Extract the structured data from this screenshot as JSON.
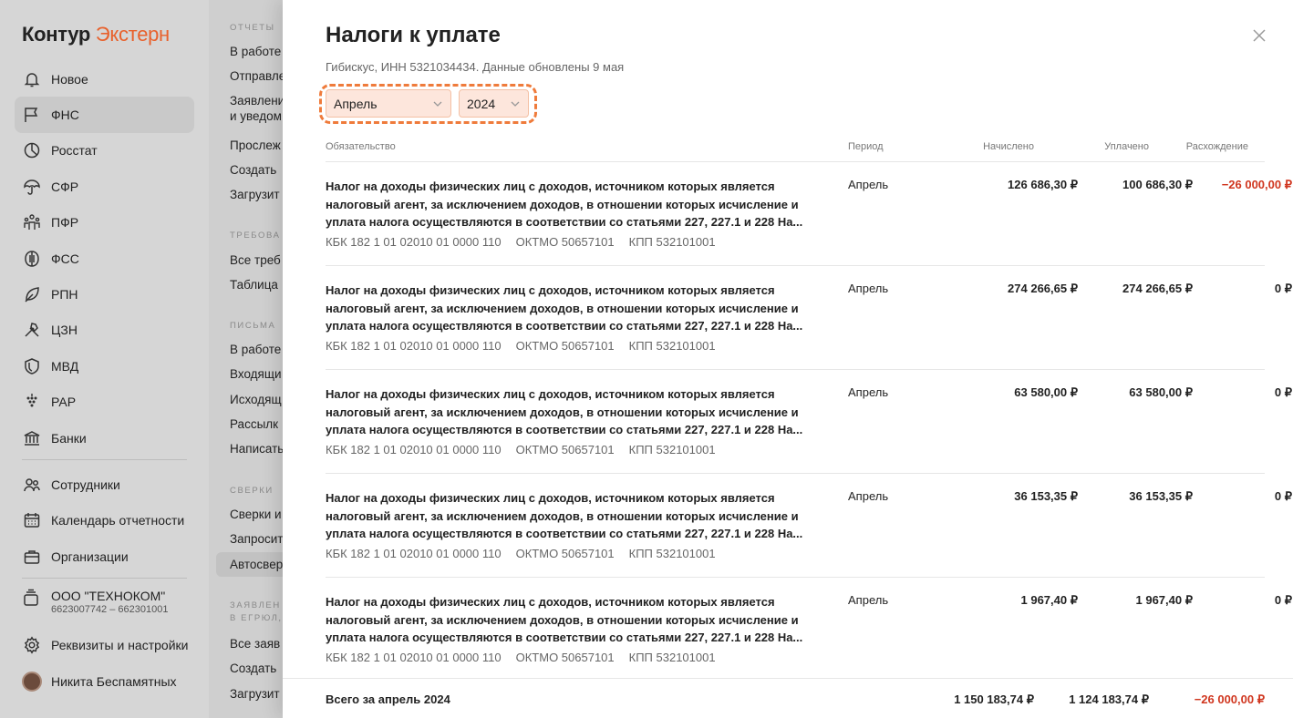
{
  "sidebar": {
    "logo_part1": "Контур",
    "logo_part2": "Экстерн",
    "items": [
      {
        "label": "Новое",
        "icon": "bell-icon"
      },
      {
        "label": "ФНС",
        "icon": "flag-icon"
      },
      {
        "label": "Росстат",
        "icon": "pie-chart-icon"
      },
      {
        "label": "СФР",
        "icon": "umbrella-icon"
      },
      {
        "label": "ПФР",
        "icon": "people-icon"
      },
      {
        "label": "ФСС",
        "icon": "shield-half-icon"
      },
      {
        "label": "РПН",
        "icon": "leaf-icon"
      },
      {
        "label": "ЦЗН",
        "icon": "tools-icon"
      },
      {
        "label": "МВД",
        "icon": "shield-icon"
      },
      {
        "label": "РАР",
        "icon": "grapes-icon"
      },
      {
        "label": "Банки",
        "icon": "bank-icon"
      }
    ],
    "extra": [
      {
        "label": "Сотрудники",
        "icon": "employees-icon"
      },
      {
        "label": "Календарь отчетности",
        "icon": "calendar-icon"
      },
      {
        "label": "Организации",
        "icon": "briefcase-icon"
      }
    ],
    "org_name": "ООО \"ТЕХНОКОМ\"",
    "org_inn": "6623007742 – 662301001",
    "settings_label": "Реквизиты и настройки",
    "user_name": "Никита Беспамятных"
  },
  "menu2": {
    "sec1_title": "ОТЧЕТЫ",
    "sec1": [
      "В работе",
      "Отправле",
      "Заявлени",
      "и уведом",
      "Прослеж",
      "Создать",
      "Загрузит"
    ],
    "sec2_title": "ТРЕБОВА",
    "sec2": [
      "Все треб",
      "Таблица"
    ],
    "sec3_title": "ПИСЬМА",
    "sec3": [
      "В работе",
      "Входящи",
      "Исходящ",
      "Рассылк",
      "Написать"
    ],
    "sec4_title": "СВЕРКИ",
    "sec4": [
      "Сверки и",
      "Запросит",
      "Автосвер"
    ],
    "sec5_title1": "ЗАЯВЛЕН",
    "sec5_title2": "В ЕГРЮЛ,",
    "sec5": [
      "Все заяв",
      "Создать",
      "Загрузит"
    ]
  },
  "modal": {
    "title": "Налоги к уплате",
    "subtitle": "Гибискус, ИНН 5321034434. Данные обновлены 9 мая",
    "month": "Апрель",
    "year": "2024",
    "columns": {
      "obligation": "Обязательство",
      "period": "Период",
      "accrued": "Начислено",
      "paid": "Уплачено",
      "diff": "Расхождение"
    },
    "rows": [
      {
        "desc": "Налог на доходы физических лиц с доходов, источником которых является налоговый агент, за исключением доходов, в отношении которых исчисление и уплата налога осуществляются в соответствии со статьями 227, 227.1 и 228 На...",
        "kbk": "КБК 182 1 01 02010 01 0000 110",
        "oktmo": "ОКТМО 50657101",
        "kpp": "КПП 532101001",
        "period": "Апрель",
        "accrued": "126 686,30 ₽",
        "paid": "100 686,30 ₽",
        "diff": "−26 000,00 ₽"
      },
      {
        "desc": "Налог на доходы физических лиц с доходов, источником которых является налоговый агент, за исключением доходов, в отношении которых исчисление и уплата налога осуществляются в соответствии со статьями 227, 227.1 и 228 На...",
        "kbk": "КБК 182 1 01 02010 01 0000 110",
        "oktmo": "ОКТМО 50657101",
        "kpp": "КПП 532101001",
        "period": "Апрель",
        "accrued": "274 266,65 ₽",
        "paid": "274 266,65 ₽",
        "diff": "0 ₽"
      },
      {
        "desc": "Налог на доходы физических лиц с доходов, источником которых является налоговый агент, за исключением доходов, в отношении которых исчисление и уплата налога осуществляются в соответствии со статьями 227, 227.1 и 228 На...",
        "kbk": "КБК 182 1 01 02010 01 0000 110",
        "oktmo": "ОКТМО 50657101",
        "kpp": "КПП 532101001",
        "period": "Апрель",
        "accrued": "63 580,00 ₽",
        "paid": "63 580,00 ₽",
        "diff": "0 ₽"
      },
      {
        "desc": "Налог на доходы физических лиц с доходов, источником которых является налоговый агент, за исключением доходов, в отношении которых исчисление и уплата налога осуществляются в соответствии со статьями 227, 227.1 и 228 На...",
        "kbk": "КБК 182 1 01 02010 01 0000 110",
        "oktmo": "ОКТМО 50657101",
        "kpp": "КПП 532101001",
        "period": "Апрель",
        "accrued": "36 153,35 ₽",
        "paid": "36 153,35 ₽",
        "diff": "0 ₽"
      },
      {
        "desc": "Налог на доходы физических лиц с доходов, источником которых является налоговый агент, за исключением доходов, в отношении которых исчисление и уплата налога осуществляются в соответствии со статьями 227, 227.1 и 228 На...",
        "kbk": "КБК 182 1 01 02010 01 0000 110",
        "oktmo": "ОКТМО 50657101",
        "kpp": "КПП 532101001",
        "period": "Апрель",
        "accrued": "1 967,40 ₽",
        "paid": "1 967,40 ₽",
        "diff": "0 ₽"
      }
    ],
    "total": {
      "label": "Всего за апрель 2024",
      "accrued": "1 150 183,74 ₽",
      "paid": "1 124 183,74 ₽",
      "diff": "−26 000,00 ₽"
    }
  },
  "colors": {
    "brand_orange": "#e8612c",
    "highlight_dash": "#ef7b3b",
    "negative_red": "#d0361f"
  }
}
